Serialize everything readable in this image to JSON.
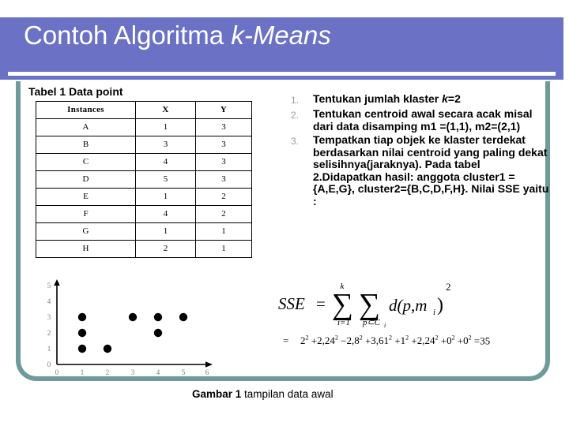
{
  "slide": {
    "title_plain": "Contoh Algoritma ",
    "title_italic": "k-Means"
  },
  "table": {
    "caption": "Tabel 1 Data point",
    "headers": [
      "Instances",
      "X",
      "Y"
    ],
    "rows": [
      [
        "A",
        "1",
        "3"
      ],
      [
        "B",
        "3",
        "3"
      ],
      [
        "C",
        "4",
        "3"
      ],
      [
        "D",
        "5",
        "3"
      ],
      [
        "E",
        "1",
        "2"
      ],
      [
        "F",
        "4",
        "2"
      ],
      [
        "G",
        "1",
        "1"
      ],
      [
        "H",
        "2",
        "1"
      ]
    ]
  },
  "steps": [
    {
      "num": "1.",
      "text_a": "Tentukan jumlah klaster ",
      "text_i": "k",
      "text_b": "=2"
    },
    {
      "num": "2.",
      "text_a": "Tentukan centroid awal secara acak misal dari data disamping m1 =(1,1), m2=(2,1)",
      "text_i": "",
      "text_b": ""
    },
    {
      "num": "3.",
      "text_a": "Tempatkan tiap objek ke klaster terdekat berdasarkan nilai centroid yang paling dekat selisihnya(jaraknya). Pada tabel 2.Didapatkan hasil: anggota cluster1 = {A,E,G}, cluster2={B,C,D,F,H}. Nilai SSE yaitu :",
      "text_i": "",
      "text_b": ""
    }
  ],
  "formula": {
    "lhs": "SSE",
    "equals": "=",
    "sum1_upper": "k",
    "sum1_lower": "i=1",
    "sum2_lower": "p⊂C",
    "sum2_lower_sub": "i",
    "term": "d(p,m",
    "term_sub": "i",
    "term_close": ")",
    "exponent": "2"
  },
  "formula_expanded": {
    "equals": "=",
    "terms": [
      {
        "base": "2",
        "exp": "2",
        "op": ""
      },
      {
        "base": "2,24",
        "exp": "2",
        "op": "+"
      },
      {
        "base": "2,8",
        "exp": "2",
        "op": "−"
      },
      {
        "base": "3,61",
        "exp": "2",
        "op": "+"
      },
      {
        "base": "1",
        "exp": "2",
        "op": "+"
      },
      {
        "base": "2,24",
        "exp": "2",
        "op": "+"
      },
      {
        "base": "0",
        "exp": "2",
        "op": "+"
      },
      {
        "base": "0",
        "exp": "2",
        "op": "+"
      }
    ],
    "result_op": "=",
    "result": "35"
  },
  "figure_caption": {
    "bold": "Gambar 1",
    "rest": "  tampilan data awal"
  },
  "chart_data": {
    "type": "scatter",
    "title": "tampilan data awal",
    "xlabel": "",
    "ylabel": "",
    "xlim": [
      0,
      6
    ],
    "ylim": [
      0,
      5
    ],
    "xticks": [
      "0",
      "1",
      "2",
      "3",
      "4",
      "5",
      "6"
    ],
    "yticks": [
      "0",
      "1",
      "2",
      "3",
      "4",
      "5"
    ],
    "grid": false,
    "legend": false,
    "point_color": "#000000",
    "points": [
      {
        "label": "A",
        "x": 1,
        "y": 3
      },
      {
        "label": "B",
        "x": 3,
        "y": 3
      },
      {
        "label": "C",
        "x": 4,
        "y": 3
      },
      {
        "label": "D",
        "x": 5,
        "y": 3
      },
      {
        "label": "E",
        "x": 1,
        "y": 2
      },
      {
        "label": "F",
        "x": 4,
        "y": 2
      },
      {
        "label": "G",
        "x": 1,
        "y": 1
      },
      {
        "label": "H",
        "x": 2,
        "y": 1
      }
    ]
  },
  "colors": {
    "header_band": "#6b71c4",
    "frame": "#6e9a9b",
    "title_text": "#ffffff",
    "list_marker": "#9a9a9a"
  }
}
